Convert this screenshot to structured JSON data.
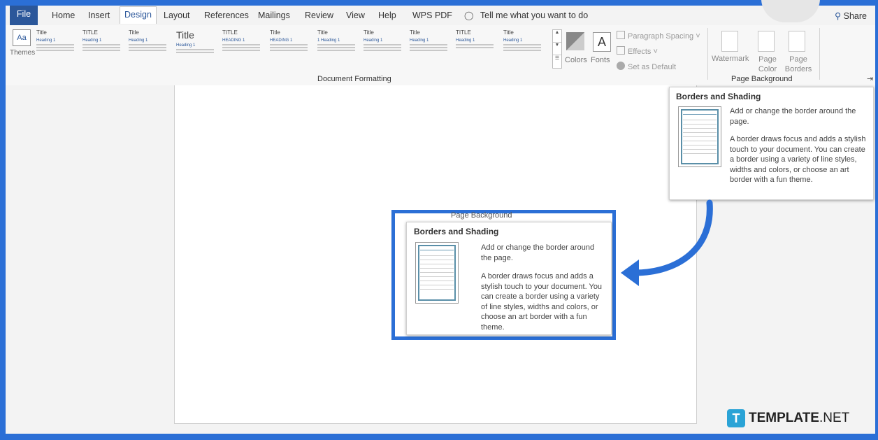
{
  "tabs": [
    "File",
    "Home",
    "Insert",
    "Design",
    "Layout",
    "References",
    "Mailings",
    "Review",
    "View",
    "Help",
    "WPS PDF"
  ],
  "active_tab": "Design",
  "tell_me": "Tell me what you want to do",
  "share": "Share",
  "themes_label": "Themes",
  "style_gallery": [
    {
      "title": "Title",
      "heading": "Heading 1"
    },
    {
      "title": "TITLE",
      "heading": "Heading 1"
    },
    {
      "title": "Title",
      "heading": "Heading 1"
    },
    {
      "title": "Title",
      "heading": "Heading 1"
    },
    {
      "title": "TITLE",
      "heading": "HEADING 1"
    },
    {
      "title": "Title",
      "heading": "HEADING 1"
    },
    {
      "title": "Title",
      "heading": "1 Heading 1"
    },
    {
      "title": "Title",
      "heading": "Heading 1"
    },
    {
      "title": "Title",
      "heading": "Heading 1"
    },
    {
      "title": "TITLE",
      "heading": "Heading 1"
    },
    {
      "title": "Title",
      "heading": "Heading 1"
    }
  ],
  "colors_label": "Colors",
  "fonts_label": "Fonts",
  "paragraph_spacing": "Paragraph Spacing",
  "effects": "Effects",
  "set_as_default": "Set as Default",
  "document_formatting": "Document Formatting",
  "watermark": "Watermark",
  "page_color": "Page Color",
  "page_borders": "Page Borders",
  "page_background": "Page Background",
  "tooltip": {
    "title": "Borders and Shading",
    "line1": "Add or change the border around the page.",
    "line2": "A border draws focus and adds a stylish touch to your document. You can create a border using a variety of line styles, widths and colors, or choose an art border with a fun theme."
  },
  "zoom_header": "Page Background",
  "logo": {
    "mark": "T",
    "brand": "TEMPLATE",
    ".net": ".NET"
  },
  "accent_color": "#2b6fd6"
}
